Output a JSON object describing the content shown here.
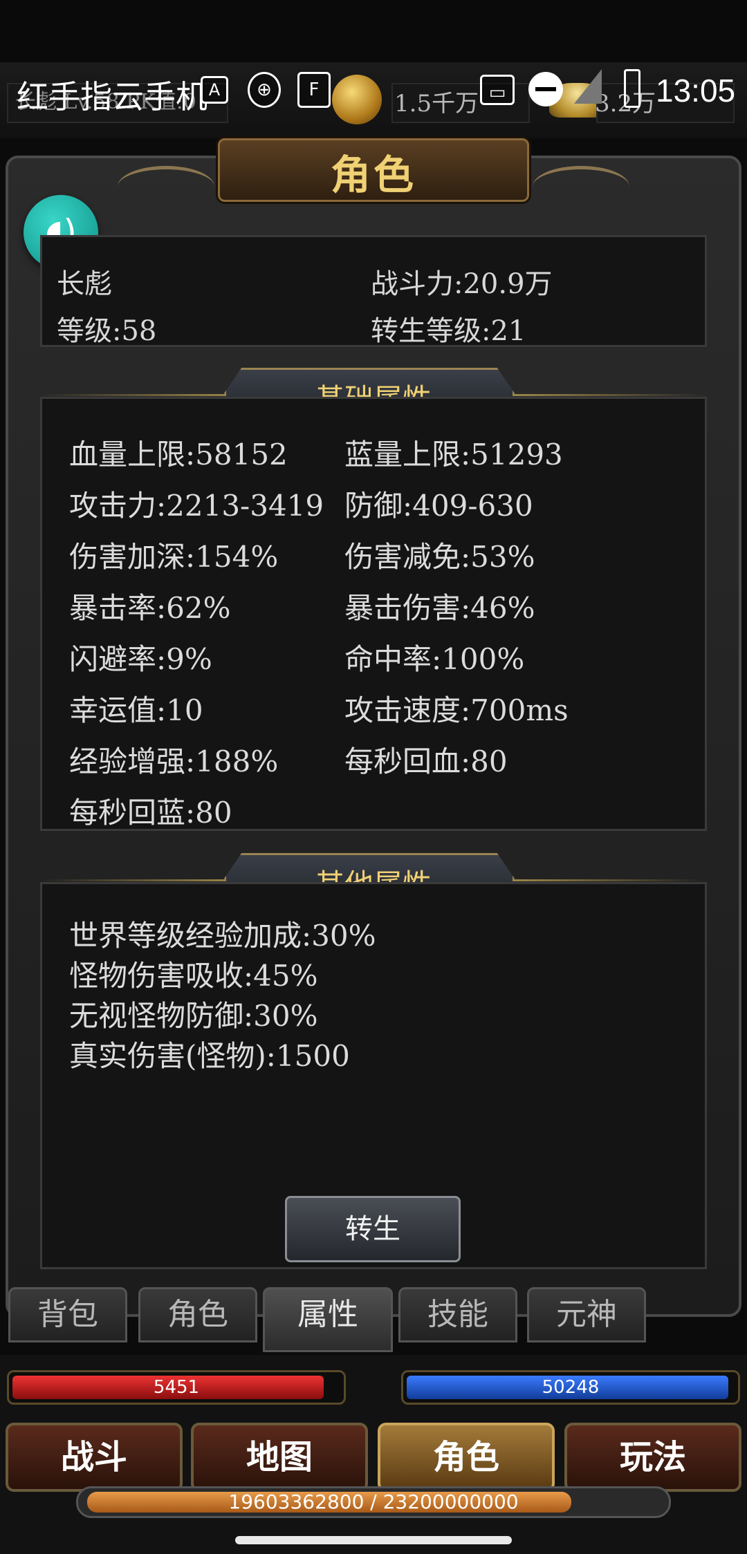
{
  "status_bar": {
    "app_name": "红手指云手机",
    "time": "13:05"
  },
  "top_bar": {
    "player_snippet": "长彪 Lv.58 PK值:0",
    "gold": "1.5千万",
    "ingot": "3.2万"
  },
  "panel": {
    "title": "角色",
    "info": {
      "name": "长彪",
      "power": "战斗力:20.9万",
      "level": "等级:58",
      "rebirth_level": "转生等级:21"
    },
    "base_section": {
      "title": "基础属性",
      "attrs": [
        "血量上限:58152",
        "蓝量上限:51293",
        "攻击力:2213-3419",
        "防御:409-630",
        "伤害加深:154%",
        "伤害减免:53%",
        "暴击率:62%",
        "暴击伤害:46%",
        "闪避率:9%",
        "命中率:100%",
        "幸运值:10",
        "攻击速度:700ms",
        "经验增强:188%",
        "每秒回血:80",
        "每秒回蓝:80"
      ]
    },
    "other_section": {
      "title": "其他属性",
      "attrs": [
        "世界等级经验加成:30%",
        "怪物伤害吸收:45%",
        "无视怪物防御:30%",
        "真实伤害(怪物):1500"
      ]
    },
    "rebirth_button": "转生"
  },
  "sub_tabs": [
    "背包",
    "角色",
    "属性",
    "技能",
    "元神"
  ],
  "active_sub_tab": "属性",
  "bars": {
    "hp": "5451",
    "hp_fraction": 0.95,
    "mp": "50248",
    "mp_fraction": 0.98
  },
  "main_tabs": [
    "战斗",
    "地图",
    "角色",
    "玩法"
  ],
  "active_main_tab": "角色",
  "exp": {
    "text": "19603362800 / 23200000000",
    "fraction": 0.845
  },
  "colors": {
    "gold_text": "#f0d174",
    "hp_bar": "#c41a1a",
    "mp_bar": "#1f5fd6",
    "exp_bar": "#e79b4a",
    "float_button": "#1fb3a8"
  },
  "icons": [
    "notification-a-icon",
    "shield-icon",
    "f-box-icon",
    "cast-icon",
    "dnd-icon",
    "signal-icon",
    "battery-icon",
    "coin-icon",
    "ingot-icon",
    "voice-icon"
  ]
}
